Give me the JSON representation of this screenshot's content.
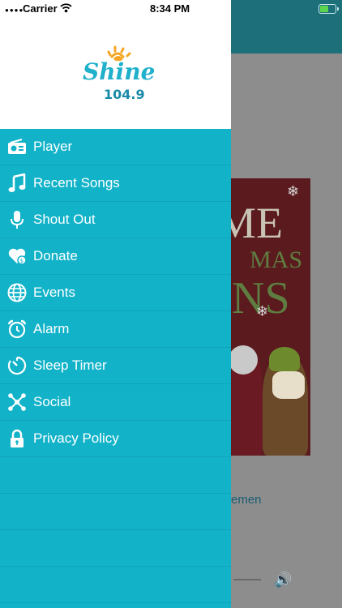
{
  "status_bar": {
    "carrier": "Carrier",
    "time": "8:34 PM",
    "battery_color": "#5bd44f"
  },
  "brand": {
    "name": "Shine",
    "frequency": "104.9",
    "accent": "#12b3c9"
  },
  "menu": {
    "items": [
      {
        "label": "Player",
        "icon": "radio-icon"
      },
      {
        "label": "Recent Songs",
        "icon": "music-note-icon"
      },
      {
        "label": "Shout Out",
        "icon": "microphone-icon"
      },
      {
        "label": "Donate",
        "icon": "heart-donate-icon"
      },
      {
        "label": "Events",
        "icon": "globe-icon"
      },
      {
        "label": "Alarm",
        "icon": "alarm-clock-icon"
      },
      {
        "label": "Sleep Timer",
        "icon": "timer-icon"
      },
      {
        "label": "Social",
        "icon": "network-icon"
      },
      {
        "label": "Privacy Policy",
        "icon": "lock-icon"
      }
    ]
  },
  "background": {
    "album_text_1": "ME",
    "album_text_2": "MAS",
    "album_text_3": "NS",
    "now_playing_partial": "emen"
  }
}
